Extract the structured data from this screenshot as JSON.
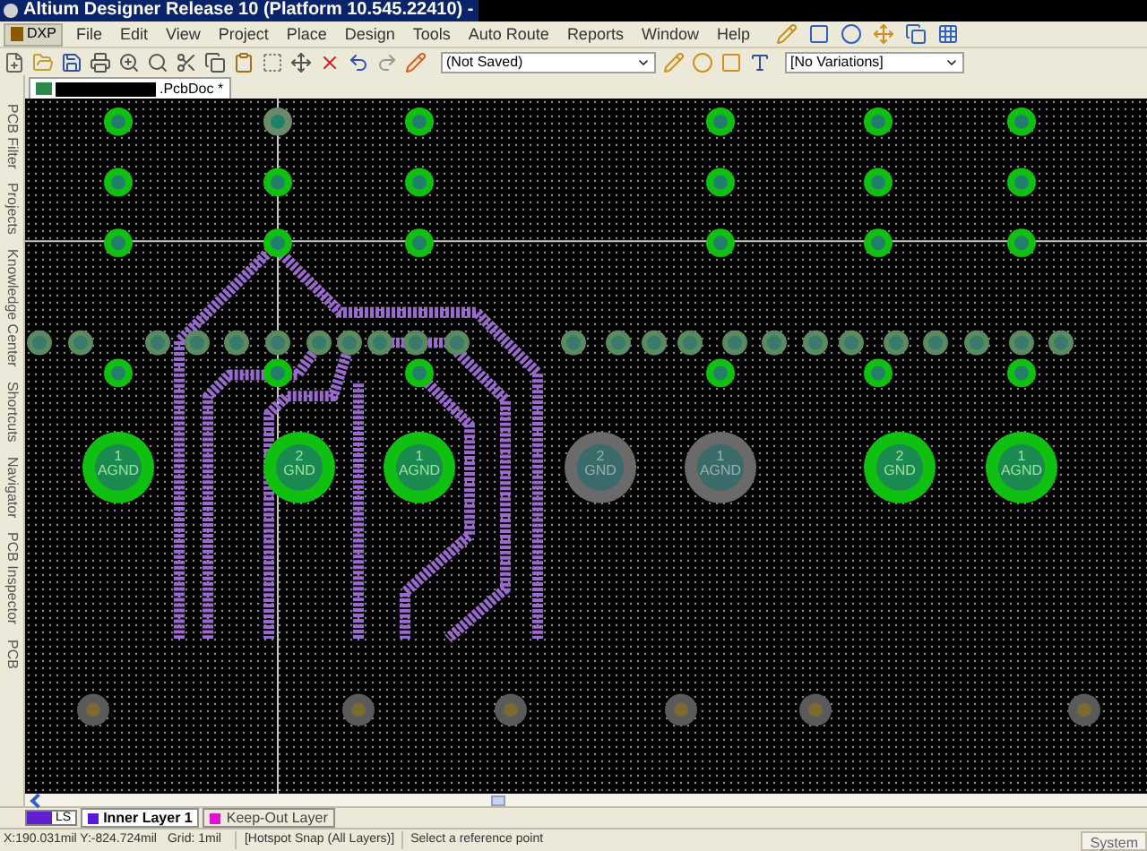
{
  "window": {
    "title": "Altium Designer Release 10 (Platform 10.545.22410) -"
  },
  "dxp_button": "DXP",
  "menu": [
    "File",
    "Edit",
    "View",
    "Project",
    "Place",
    "Design",
    "Tools",
    "Auto Route",
    "Reports",
    "Window",
    "Help"
  ],
  "toolbar": {
    "layer_set": "(Not Saved)",
    "variations": "[No Variations]"
  },
  "document_tab": {
    "title": ".PcbDoc *"
  },
  "side_panels": [
    "PCB Filter",
    "Projects",
    "Knowledge Center",
    "Shortcuts",
    "Navigator",
    "PCB Inspector",
    "PCB"
  ],
  "pads": [
    {
      "number": "1",
      "net": "AGND",
      "dimmed": false
    },
    {
      "number": "2",
      "net": "GND",
      "dimmed": false
    },
    {
      "number": "1",
      "net": "AGND",
      "dimmed": false
    },
    {
      "number": "2",
      "net": "GND",
      "dimmed": true
    },
    {
      "number": "1",
      "net": "AGND",
      "dimmed": true
    },
    {
      "number": "2",
      "net": "GND",
      "dimmed": false
    },
    {
      "number": "1",
      "net": "AGND",
      "dimmed": false
    }
  ],
  "layer_set_button": "LS",
  "layer_tabs": [
    {
      "label": "Inner Layer 1",
      "color": "#5a18d8",
      "selected": true
    },
    {
      "label": "Keep-Out Layer",
      "color": "#e010d0",
      "selected": false
    }
  ],
  "status_bar": {
    "coordinates": "X:190.031mil Y:-824.724mil",
    "grid": "Grid: 1mil",
    "snap": "[Hotspot Snap (All Layers)]",
    "prompt": "Select a reference point",
    "system_button": "System"
  }
}
